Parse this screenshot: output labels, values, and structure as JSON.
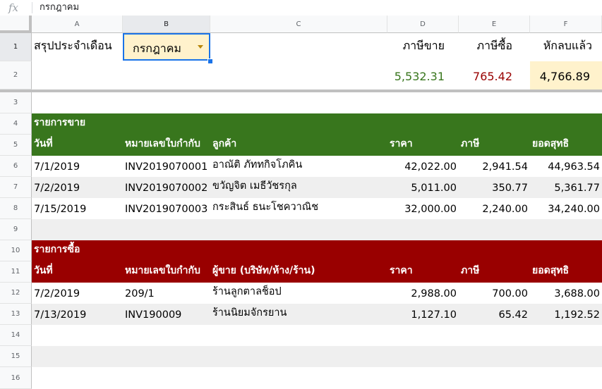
{
  "formula_bar": {
    "icon": "fx",
    "value": "กรกฎาคม"
  },
  "columns": [
    "A",
    "B",
    "C",
    "D",
    "E",
    "F"
  ],
  "rows": [
    "1",
    "2",
    "3",
    "4",
    "5",
    "6",
    "7",
    "8",
    "9",
    "10",
    "11",
    "12",
    "13",
    "14",
    "15",
    "16"
  ],
  "summary": {
    "label": "สรุปประจำเดือน",
    "month": "กรกฎาคม",
    "sales_tax_label": "ภาษีขาย",
    "purchase_tax_label": "ภาษีซื้อ",
    "net_label": "หักลบแล้ว",
    "sales_tax_value": "5,532.31",
    "purchase_tax_value": "765.42",
    "net_value": "4,766.89"
  },
  "sales": {
    "title": "รายการขาย",
    "headers": [
      "วันที่",
      "หมายเลขใบกำกับ",
      "ลูกค้า",
      "ราคา",
      "ภาษี",
      "ยอดสุทธิ"
    ],
    "rows": [
      [
        "7/1/2019",
        "INV2019070001",
        "อาณัติ ภัททกิจโภคิน",
        "42,022.00",
        "2,941.54",
        "44,963.54"
      ],
      [
        "7/2/2019",
        "INV2019070002",
        "ขวัญจิต เมธีวัชรกุล",
        "5,011.00",
        "350.77",
        "5,361.77"
      ],
      [
        "7/15/2019",
        "INV2019070003",
        "กระสินธ์ ธนะโชควาณิช",
        "32,000.00",
        "2,240.00",
        "34,240.00"
      ]
    ]
  },
  "purchases": {
    "title": "รายการซื้อ",
    "headers": [
      "วันที่",
      "หมายเลขใบกำกับ",
      "ผู้ขาย (บริษัท/ห้าง/ร้าน)",
      "ราคา",
      "ภาษี",
      "ยอดสุทธิ"
    ],
    "rows": [
      [
        "7/2/2019",
        "209/1",
        "ร้านลูกตาลช็อป",
        "2,988.00",
        "700.00",
        "3,688.00"
      ],
      [
        "7/13/2019",
        "INV190009",
        "ร้านนิยมจักรยาน",
        "1,127.10",
        "65.42",
        "1,192.52"
      ]
    ]
  },
  "colors": {
    "sales_green": "#38761d",
    "purchase_red": "#990000",
    "sales_tax_text": "#38761d",
    "purchase_tax_text": "#990000",
    "highlight_yellow": "#fff2cc",
    "selection_blue": "#1a73e8"
  }
}
